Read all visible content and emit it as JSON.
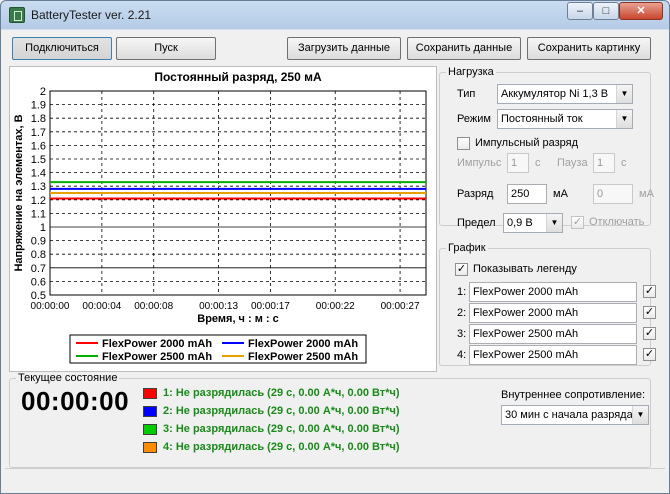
{
  "window": {
    "title": "BatteryTester ver. 2.21",
    "minimize_glyph": "–",
    "maximize_glyph": "□",
    "close_glyph": "✕"
  },
  "toolbar": {
    "connect": "Подключиться",
    "start": "Пуск",
    "load_data": "Загрузить данные",
    "save_data": "Сохранить данные",
    "save_picture": "Сохранить картинку"
  },
  "load": {
    "group_title": "Нагрузка",
    "type_label": "Тип",
    "type_value": "Аккумулятор Ni 1,3 В",
    "mode_label": "Режим",
    "mode_value": "Постоянный ток",
    "pulse_label": "Импульсный разряд",
    "pulse_checked": false,
    "impulse_label": "Импульс",
    "impulse_value": "1",
    "impulse_unit": "с",
    "pause_label": "Пауза",
    "pause_value": "1",
    "pause_unit": "с",
    "discharge_label": "Разряд",
    "discharge_value": "250",
    "discharge_unit": "мА",
    "discharge_value2": "0",
    "discharge_unit2": "мА",
    "limit_label": "Предел",
    "limit_value": "0,9 В",
    "disconnect_label": "Отключать",
    "disconnect_checked": true
  },
  "graph_group": {
    "group_title": "График",
    "show_legend_label": "Показывать легенду",
    "show_legend_checked": true,
    "series": [
      {
        "index": "1:",
        "name": "FlexPower 2000 mAh",
        "checked": true
      },
      {
        "index": "2:",
        "name": "FlexPower 2000 mAh",
        "checked": true
      },
      {
        "index": "3:",
        "name": "FlexPower 2500 mAh",
        "checked": true
      },
      {
        "index": "4:",
        "name": "FlexPower 2500 mAh",
        "checked": true
      }
    ]
  },
  "current_state": {
    "group_title": "Текущее состояние",
    "timer": "00:00:00",
    "lines": [
      {
        "text": "1: Не разрядилась (29 с, 0.00 А*ч, 0.00 Вт*ч)",
        "color": "#ff0000"
      },
      {
        "text": "2: Не разрядилась (29 с, 0.00 А*ч, 0.00 Вт*ч)",
        "color": "#0000ff"
      },
      {
        "text": "3: Не разрядилась (29 с, 0.00 А*ч, 0.00 Вт*ч)",
        "color": "#00cc00"
      },
      {
        "text": "4: Не разрядилась (29 с, 0.00 А*ч, 0.00 Вт*ч)",
        "color": "#ff8c00"
      }
    ],
    "internal_resistance_label": "Внутреннее сопротивление:",
    "internal_resistance_value": "30 мин с начала разряда"
  },
  "chart_data": {
    "type": "line",
    "title": "Постоянный разряд, 250 мА",
    "xlabel": "Время, ч : м : с",
    "ylabel": "Напряжение на элементах, В",
    "ylim": [
      0.5,
      2
    ],
    "yticks": [
      "0.5",
      "0.6",
      "0.7",
      "0.8",
      "0.9",
      "1",
      "1.1",
      "1.2",
      "1.3",
      "1.4",
      "1.5",
      "1.6",
      "1.7",
      "1.8",
      "1.9",
      "2"
    ],
    "xlim": [
      "00:00:00",
      "00:00:29"
    ],
    "xticks": [
      "00:00:00",
      "00:00:04",
      "00:00:08",
      "00:00:13",
      "00:00:17",
      "00:00:22",
      "00:00:27"
    ],
    "grid": true,
    "series": [
      {
        "name": "FlexPower 2000 mAh",
        "color": "#ff0000",
        "x": [
          "00:00:00",
          "00:00:29"
        ],
        "y": [
          1.21,
          1.21
        ]
      },
      {
        "name": "FlexPower 2000 mAh",
        "color": "#0000ff",
        "x": [
          "00:00:00",
          "00:00:29"
        ],
        "y": [
          1.28,
          1.28
        ]
      },
      {
        "name": "FlexPower 2500 mAh",
        "color": "#00b000",
        "x": [
          "00:00:00",
          "00:00:29"
        ],
        "y": [
          1.33,
          1.33
        ]
      },
      {
        "name": "FlexPower 2500 mAh",
        "color": "#e8a000",
        "x": [
          "00:00:00",
          "00:00:29"
        ],
        "y": [
          1.25,
          1.25
        ]
      }
    ],
    "legend_location": "bottom-center"
  }
}
